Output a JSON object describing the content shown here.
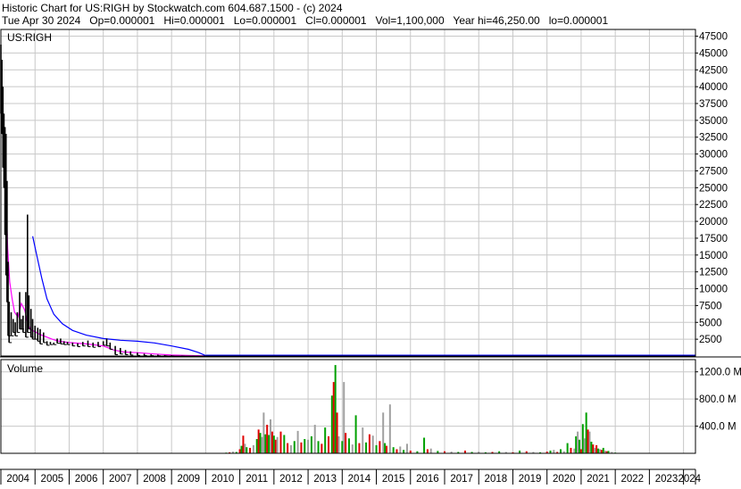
{
  "header": {
    "line1": "Historic Chart for US:RIGH by Stockwatch.com 604.687.1500 - (c) 2024",
    "line2": "Tue Apr 30 2024   Op=0.000001   Hi=0.000001   Lo=0.000001   Cl=0.000001   Vol=1,100,000   Year hi=46,250.00   lo=0.000001"
  },
  "colors": {
    "up": "#00a000",
    "down": "#e00000",
    "neutral": "#a0a0a0",
    "ma_short": "#ff00ff",
    "ma_long": "#0000ff",
    "grid": "#c8c8c8",
    "price": "#000000"
  },
  "chart_data": [
    {
      "type": "line",
      "title": "US:RIGH",
      "ylim": [
        0,
        48500
      ],
      "yticks": [
        2500,
        5000,
        7500,
        10000,
        12500,
        15000,
        17500,
        20000,
        22500,
        25000,
        27500,
        30000,
        32500,
        35000,
        37500,
        40000,
        42500,
        45000,
        47500
      ],
      "ytick_labels": [
        "2500",
        "5000",
        "7500",
        "10000",
        "12500",
        "15000",
        "17500",
        "20000",
        "22500",
        "25000",
        "27500",
        "30000",
        "32500",
        "35000",
        "37500",
        "40000",
        "42500",
        "45000",
        "47500"
      ],
      "x_labels": [
        "2004",
        "2005",
        "2006",
        "2007",
        "2008",
        "2009",
        "2010",
        "2011",
        "2012",
        "2013",
        "2014",
        "2015",
        "2016",
        "2017",
        "2018",
        "2019",
        "2020",
        "2021",
        "2022",
        "2023",
        "2024"
      ],
      "x_start": 2004.0,
      "x_end": 2024.35,
      "price_bars": [
        [
          2004.0,
          46250,
          36000
        ],
        [
          2004.03,
          44000,
          33000
        ],
        [
          2004.06,
          40000,
          28000
        ],
        [
          2004.09,
          36000,
          25000
        ],
        [
          2004.12,
          34000,
          18000
        ],
        [
          2004.15,
          33000,
          12000
        ],
        [
          2004.18,
          26000,
          8000
        ],
        [
          2004.21,
          14000,
          3000
        ],
        [
          2004.24,
          8000,
          2000
        ],
        [
          2004.3,
          6500,
          3000
        ],
        [
          2004.36,
          5500,
          3500
        ],
        [
          2004.42,
          5000,
          3000
        ],
        [
          2004.48,
          6500,
          3500
        ],
        [
          2004.55,
          9500,
          4000
        ],
        [
          2004.6,
          5500,
          4000
        ],
        [
          2004.65,
          6000,
          3500
        ],
        [
          2004.73,
          9500,
          2800
        ],
        [
          2004.78,
          21000,
          3500
        ],
        [
          2004.82,
          9000,
          4000
        ],
        [
          2004.88,
          7000,
          2800
        ],
        [
          2004.93,
          5500,
          2500
        ],
        [
          2005.0,
          4500,
          2500
        ],
        [
          2005.08,
          4200,
          2200
        ],
        [
          2005.15,
          4000,
          1800
        ],
        [
          2005.25,
          3500,
          2000
        ],
        [
          2005.35,
          2200,
          1600
        ],
        [
          2005.45,
          2100,
          1700
        ],
        [
          2005.55,
          2000,
          1700
        ],
        [
          2005.65,
          2600,
          1900
        ],
        [
          2005.75,
          2600,
          1800
        ],
        [
          2005.85,
          2200,
          1700
        ],
        [
          2005.95,
          2100,
          1700
        ],
        [
          2006.1,
          2000,
          1500
        ],
        [
          2006.25,
          1900,
          1400
        ],
        [
          2006.4,
          2100,
          1500
        ],
        [
          2006.55,
          2300,
          1400
        ],
        [
          2006.7,
          2000,
          1300
        ],
        [
          2006.85,
          2100,
          1400
        ],
        [
          2007.0,
          2200,
          1600
        ],
        [
          2007.1,
          2600,
          1500
        ],
        [
          2007.2,
          2000,
          1000
        ],
        [
          2007.35,
          1500,
          200
        ],
        [
          2007.5,
          1200,
          300
        ],
        [
          2007.65,
          900,
          200
        ],
        [
          2007.8,
          700,
          150
        ],
        [
          2008.0,
          500,
          100
        ],
        [
          2008.2,
          350,
          80
        ],
        [
          2008.4,
          250,
          60
        ],
        [
          2008.6,
          200,
          40
        ],
        [
          2008.8,
          150,
          30
        ],
        [
          2009.0,
          120,
          20
        ],
        [
          2009.3,
          80,
          10
        ],
        [
          2009.6,
          50,
          5
        ],
        [
          2010.0,
          20,
          1
        ],
        [
          2010.5,
          5,
          0
        ]
      ],
      "series": [
        {
          "name": "",
          "color_key": "ma_short",
          "points": [
            [
              2004.03,
              33500
            ],
            [
              2004.08,
              34000
            ],
            [
              2004.12,
              30000
            ],
            [
              2004.16,
              22000
            ],
            [
              2004.2,
              16000
            ],
            [
              2004.26,
              11000
            ],
            [
              2004.33,
              8500
            ],
            [
              2004.4,
              6500
            ],
            [
              2004.5,
              5800
            ],
            [
              2004.6,
              7800
            ],
            [
              2004.7,
              6800
            ],
            [
              2004.8,
              4500
            ],
            [
              2004.9,
              3900
            ],
            [
              2005.0,
              3600
            ],
            [
              2005.15,
              3200
            ],
            [
              2005.3,
              2900
            ],
            [
              2005.5,
              2500
            ],
            [
              2005.7,
              2200
            ],
            [
              2006.0,
              2000
            ],
            [
              2006.5,
              1800
            ],
            [
              2007.0,
              1500
            ],
            [
              2007.3,
              900
            ],
            [
              2007.6,
              600
            ],
            [
              2008.0,
              500
            ],
            [
              2008.5,
              300
            ],
            [
              2009.0,
              150
            ],
            [
              2009.5,
              80
            ],
            [
              2010.0,
              30
            ],
            [
              2011.0,
              5
            ],
            [
              2024.3,
              0
            ]
          ]
        },
        {
          "name": "",
          "color_key": "ma_long",
          "points": [
            [
              2004.93,
              17800
            ],
            [
              2005.05,
              15000
            ],
            [
              2005.2,
              11500
            ],
            [
              2005.35,
              8500
            ],
            [
              2005.55,
              6200
            ],
            [
              2005.8,
              4800
            ],
            [
              2006.1,
              3800
            ],
            [
              2006.5,
              3100
            ],
            [
              2007.0,
              2600
            ],
            [
              2007.5,
              2350
            ],
            [
              2008.0,
              2200
            ],
            [
              2008.5,
              1950
            ],
            [
              2009.0,
              1500
            ],
            [
              2009.5,
              1000
            ],
            [
              2009.8,
              500
            ],
            [
              2010.0,
              60
            ],
            [
              2010.5,
              10
            ],
            [
              2024.3,
              0
            ]
          ]
        }
      ]
    },
    {
      "type": "bar",
      "title": "Volume",
      "ylim": [
        0,
        1380
      ],
      "yticks": [
        400,
        800,
        1200
      ],
      "ytick_labels": [
        "400.0 M",
        "800.0 M",
        "1200.0 M"
      ],
      "bars": [
        [
          2010.6,
          10,
          "up"
        ],
        [
          2010.7,
          15,
          "down"
        ],
        [
          2010.8,
          25,
          "neutral"
        ],
        [
          2010.9,
          20,
          "up"
        ],
        [
          2011.0,
          60,
          "down"
        ],
        [
          2011.05,
          110,
          "up"
        ],
        [
          2011.1,
          260,
          "down"
        ],
        [
          2011.15,
          140,
          "neutral"
        ],
        [
          2011.2,
          90,
          "up"
        ],
        [
          2011.3,
          80,
          "down"
        ],
        [
          2011.4,
          120,
          "neutral"
        ],
        [
          2011.5,
          210,
          "up"
        ],
        [
          2011.55,
          350,
          "down"
        ],
        [
          2011.6,
          300,
          "up"
        ],
        [
          2011.65,
          240,
          "neutral"
        ],
        [
          2011.7,
          600,
          "neutral"
        ],
        [
          2011.75,
          280,
          "up"
        ],
        [
          2011.8,
          420,
          "down"
        ],
        [
          2011.85,
          270,
          "up"
        ],
        [
          2011.9,
          500,
          "neutral"
        ],
        [
          2011.95,
          320,
          "down"
        ],
        [
          2012.0,
          260,
          "up"
        ],
        [
          2012.05,
          200,
          "down"
        ],
        [
          2012.1,
          240,
          "neutral"
        ],
        [
          2012.2,
          320,
          "down"
        ],
        [
          2012.3,
          270,
          "up"
        ],
        [
          2012.4,
          150,
          "down"
        ],
        [
          2012.5,
          120,
          "neutral"
        ],
        [
          2012.6,
          180,
          "up"
        ],
        [
          2012.7,
          330,
          "neutral"
        ],
        [
          2012.8,
          160,
          "down"
        ],
        [
          2012.9,
          210,
          "up"
        ],
        [
          2013.0,
          200,
          "neutral"
        ],
        [
          2013.1,
          250,
          "up"
        ],
        [
          2013.2,
          420,
          "neutral"
        ],
        [
          2013.3,
          180,
          "up"
        ],
        [
          2013.4,
          140,
          "down"
        ],
        [
          2013.5,
          380,
          "up"
        ],
        [
          2013.6,
          250,
          "down"
        ],
        [
          2013.7,
          850,
          "up"
        ],
        [
          2013.75,
          1050,
          "down"
        ],
        [
          2013.8,
          1300,
          "up"
        ],
        [
          2013.85,
          600,
          "down"
        ],
        [
          2013.9,
          250,
          "neutral"
        ],
        [
          2014.0,
          180,
          "up"
        ],
        [
          2014.05,
          1050,
          "neutral"
        ],
        [
          2014.1,
          300,
          "down"
        ],
        [
          2014.2,
          220,
          "up"
        ],
        [
          2014.3,
          130,
          "neutral"
        ],
        [
          2014.4,
          560,
          "up"
        ],
        [
          2014.5,
          150,
          "down"
        ],
        [
          2014.6,
          380,
          "neutral"
        ],
        [
          2014.7,
          160,
          "up"
        ],
        [
          2014.8,
          280,
          "down"
        ],
        [
          2014.9,
          260,
          "neutral"
        ],
        [
          2015.0,
          120,
          "up"
        ],
        [
          2015.1,
          180,
          "down"
        ],
        [
          2015.2,
          600,
          "neutral"
        ],
        [
          2015.25,
          150,
          "up"
        ],
        [
          2015.3,
          110,
          "down"
        ],
        [
          2015.4,
          720,
          "neutral"
        ],
        [
          2015.5,
          90,
          "up"
        ],
        [
          2015.6,
          60,
          "down"
        ],
        [
          2015.7,
          100,
          "neutral"
        ],
        [
          2015.8,
          50,
          "up"
        ],
        [
          2015.9,
          140,
          "neutral"
        ],
        [
          2016.0,
          40,
          "down"
        ],
        [
          2016.2,
          30,
          "up"
        ],
        [
          2016.4,
          230,
          "up"
        ],
        [
          2016.5,
          60,
          "down"
        ],
        [
          2016.6,
          70,
          "neutral"
        ],
        [
          2016.8,
          35,
          "up"
        ],
        [
          2017.0,
          30,
          "down"
        ],
        [
          2017.2,
          25,
          "neutral"
        ],
        [
          2017.4,
          20,
          "up"
        ],
        [
          2017.6,
          40,
          "down"
        ],
        [
          2017.8,
          20,
          "up"
        ],
        [
          2018.0,
          25,
          "neutral"
        ],
        [
          2018.2,
          15,
          "up"
        ],
        [
          2018.4,
          20,
          "down"
        ],
        [
          2018.6,
          30,
          "up"
        ],
        [
          2018.8,
          20,
          "neutral"
        ],
        [
          2019.0,
          15,
          "down"
        ],
        [
          2019.2,
          40,
          "up"
        ],
        [
          2019.4,
          30,
          "down"
        ],
        [
          2019.6,
          20,
          "neutral"
        ],
        [
          2019.8,
          15,
          "up"
        ],
        [
          2020.0,
          25,
          "down"
        ],
        [
          2020.1,
          40,
          "up"
        ],
        [
          2020.2,
          50,
          "neutral"
        ],
        [
          2020.3,
          20,
          "down"
        ],
        [
          2020.4,
          60,
          "up"
        ],
        [
          2020.5,
          30,
          "neutral"
        ],
        [
          2020.6,
          150,
          "up"
        ],
        [
          2020.7,
          80,
          "down"
        ],
        [
          2020.8,
          70,
          "neutral"
        ],
        [
          2020.85,
          250,
          "up"
        ],
        [
          2020.9,
          320,
          "neutral"
        ],
        [
          2020.95,
          200,
          "up"
        ],
        [
          2021.0,
          60,
          "down"
        ],
        [
          2021.05,
          430,
          "up"
        ],
        [
          2021.1,
          220,
          "neutral"
        ],
        [
          2021.15,
          600,
          "up"
        ],
        [
          2021.2,
          350,
          "down"
        ],
        [
          2021.25,
          320,
          "neutral"
        ],
        [
          2021.3,
          170,
          "up"
        ],
        [
          2021.35,
          130,
          "down"
        ],
        [
          2021.4,
          80,
          "neutral"
        ],
        [
          2021.45,
          120,
          "down"
        ],
        [
          2021.5,
          70,
          "up"
        ],
        [
          2021.55,
          60,
          "neutral"
        ],
        [
          2021.6,
          50,
          "down"
        ],
        [
          2021.65,
          80,
          "up"
        ],
        [
          2021.7,
          40,
          "neutral"
        ],
        [
          2021.75,
          30,
          "down"
        ],
        [
          2021.8,
          35,
          "up"
        ],
        [
          2021.9,
          20,
          "neutral"
        ],
        [
          2022.0,
          10,
          "up"
        ]
      ]
    }
  ]
}
